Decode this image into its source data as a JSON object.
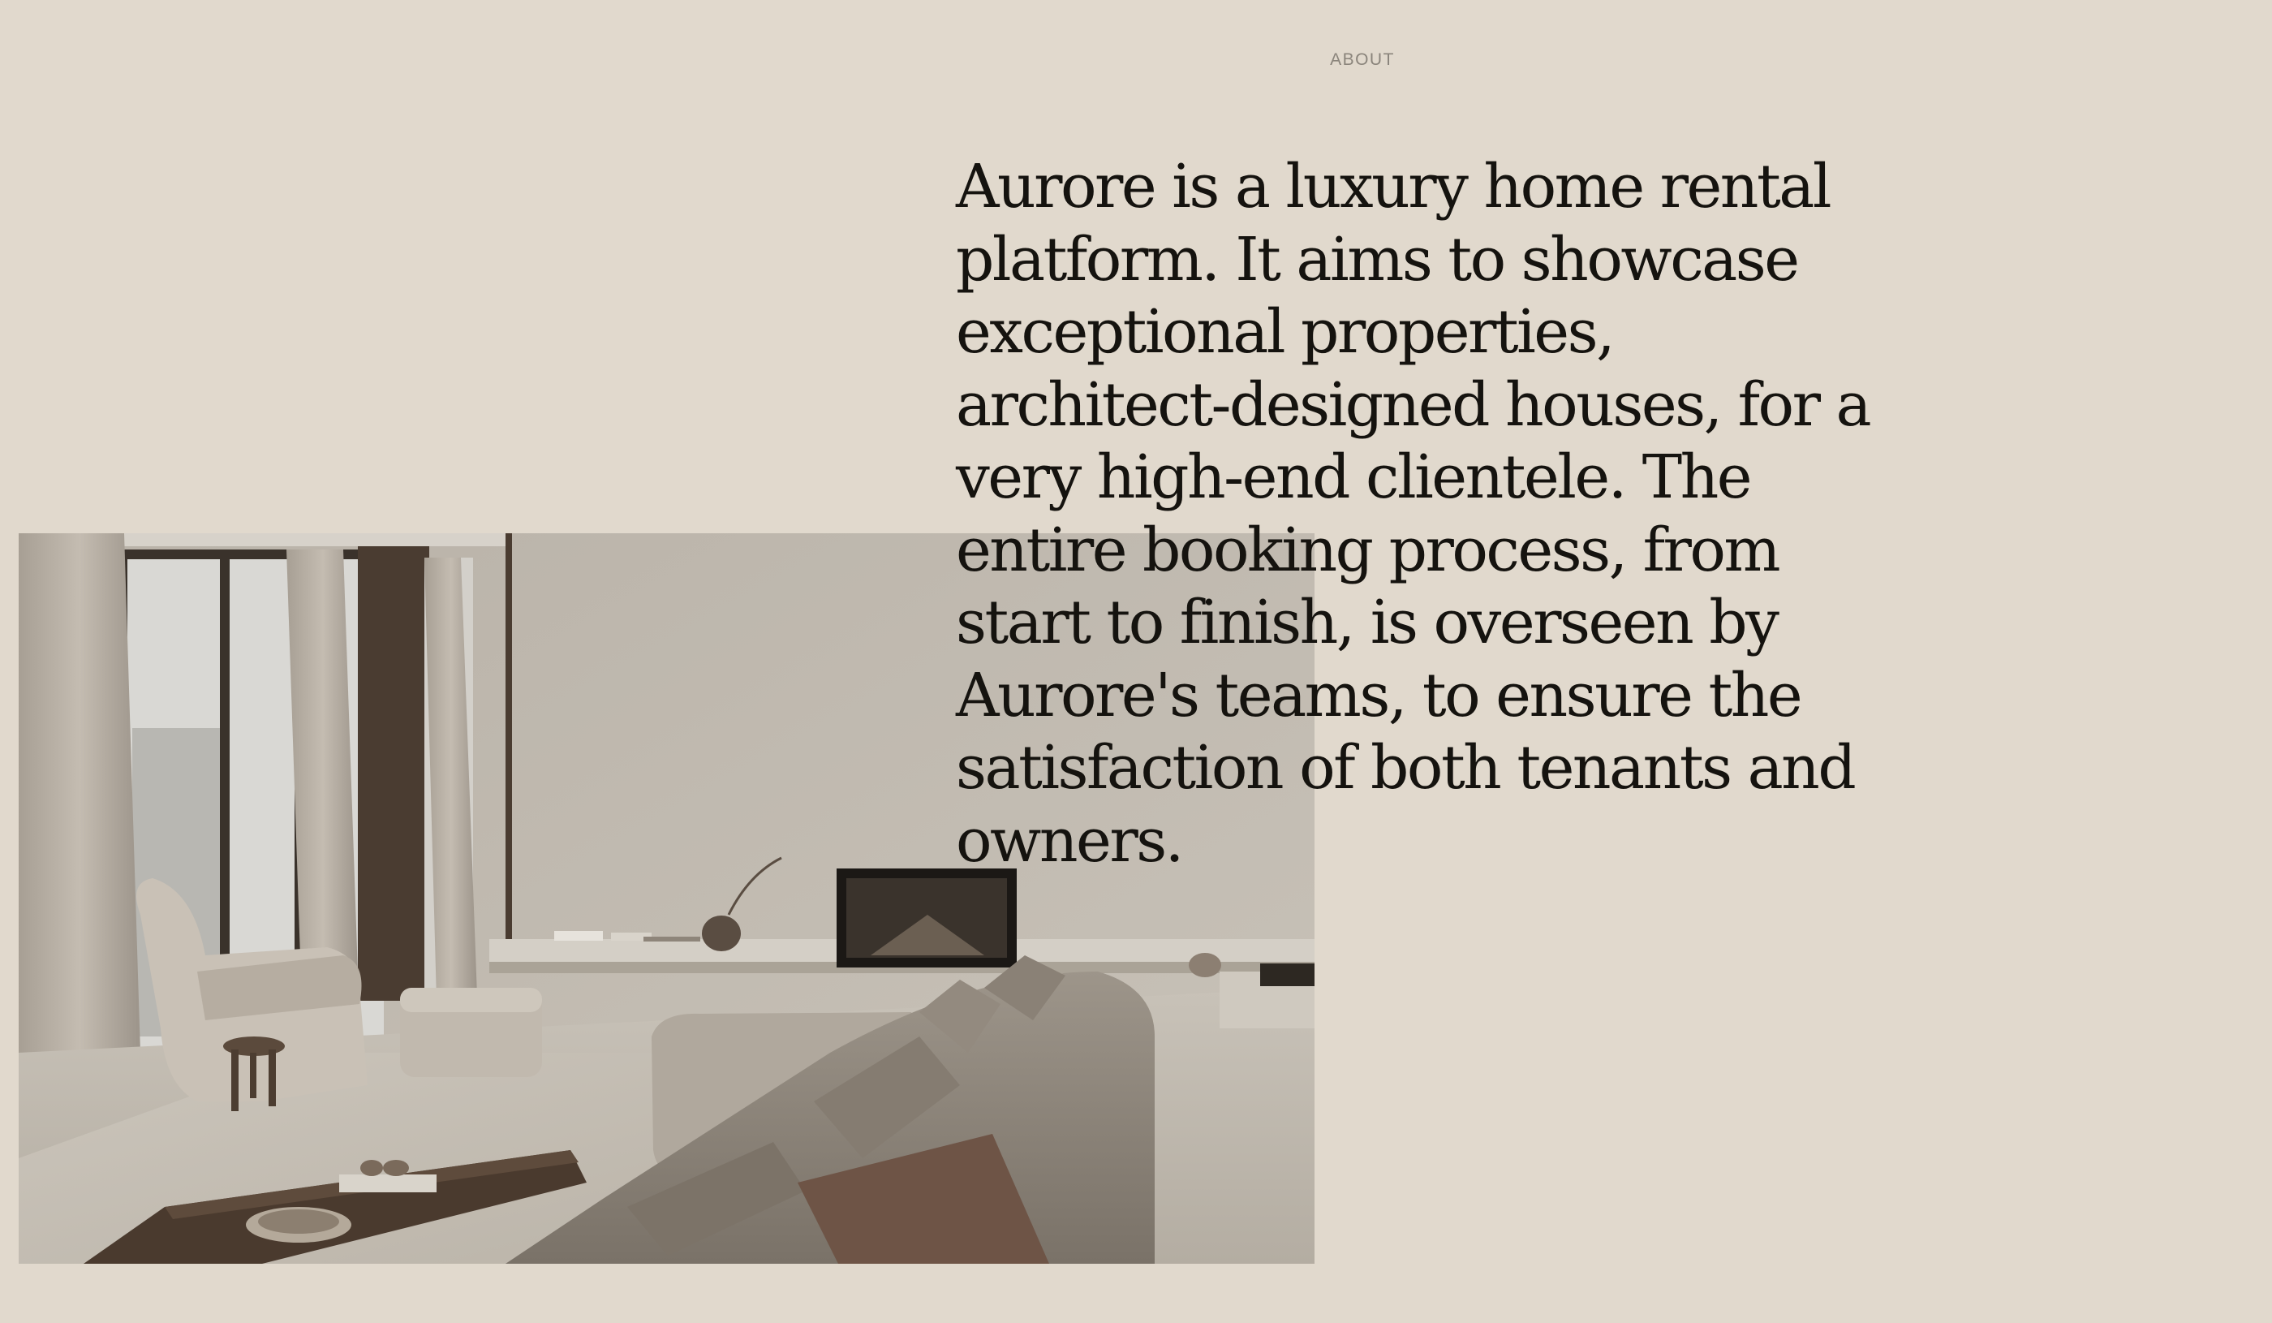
{
  "section": {
    "label": "ABOUT"
  },
  "about": {
    "text": "Aurore is a luxury home rental platform. It aims to showcase exceptional properties, architect-designed houses, for a very high-end clientele. The entire booking process, from start to finish, is overseen by Aurore's teams, to ensure the satisfaction of both tenants and owners."
  },
  "colors": {
    "background": "#e1d9cd",
    "text": "#15130f",
    "label": "#8a847b"
  }
}
